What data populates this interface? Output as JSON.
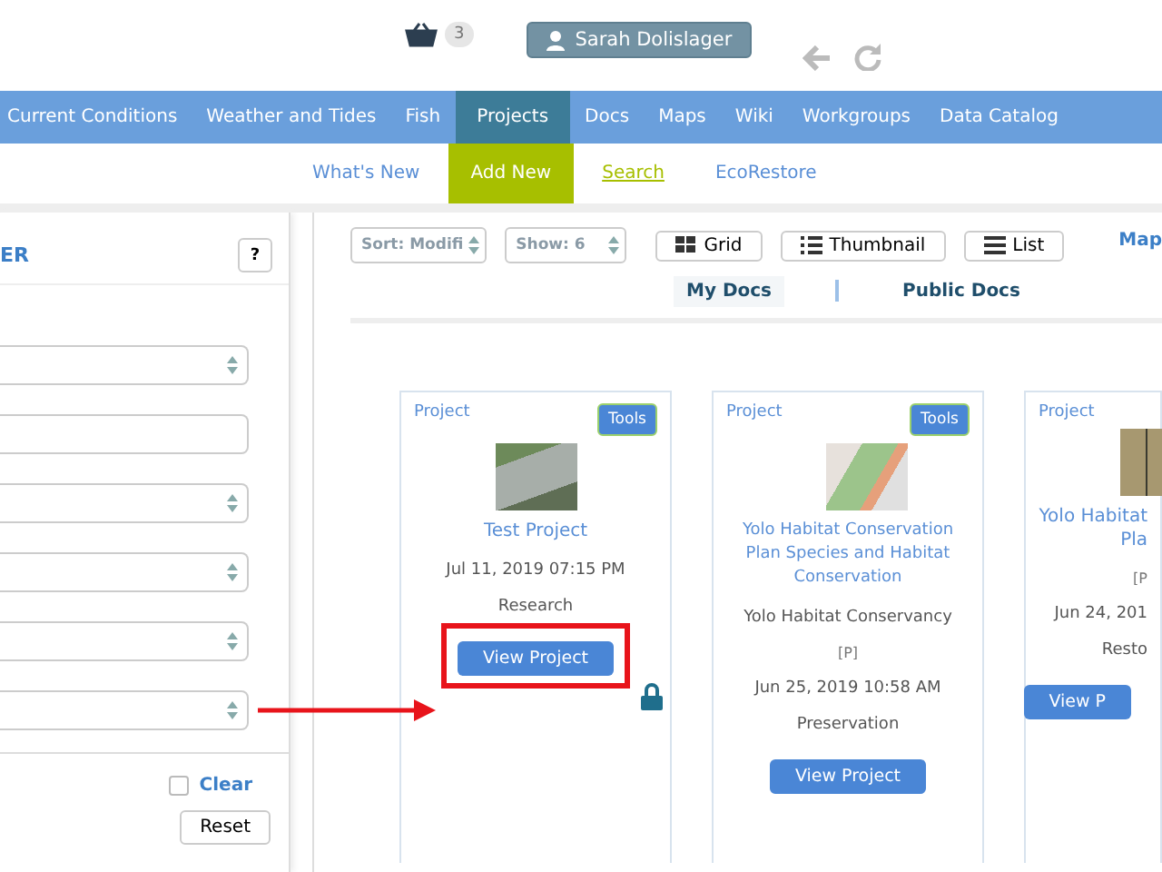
{
  "header": {
    "cart_count": "3",
    "user": "Sarah Dolislager"
  },
  "nav": [
    {
      "label": "Current Conditions",
      "selected": false
    },
    {
      "label": "Weather and Tides",
      "selected": false
    },
    {
      "label": "Fish",
      "selected": false
    },
    {
      "label": "Projects",
      "selected": true
    },
    {
      "label": "Docs",
      "selected": false
    },
    {
      "label": "Maps",
      "selected": false
    },
    {
      "label": "Wiki",
      "selected": false
    },
    {
      "label": "Workgroups",
      "selected": false
    },
    {
      "label": "Data Catalog",
      "selected": false
    }
  ],
  "subnav": [
    {
      "label": "What's New",
      "selected": false,
      "underlined": false
    },
    {
      "label": "Add New",
      "selected": true,
      "underlined": false
    },
    {
      "label": "Search",
      "selected": false,
      "underlined": true
    },
    {
      "label": "EcoRestore",
      "selected": false,
      "underlined": false
    }
  ],
  "filter_panel": {
    "title": "ER",
    "help": "?",
    "fields": [
      {
        "kind": "select"
      },
      {
        "kind": "input"
      },
      {
        "kind": "select"
      },
      {
        "kind": "select"
      },
      {
        "kind": "select"
      },
      {
        "kind": "select"
      }
    ],
    "clear": {
      "label": "Clear",
      "checked": false
    },
    "reset": "Reset"
  },
  "toolbar": {
    "sort": "Sort: Modifi",
    "show": "Show: 6",
    "views": [
      {
        "kind": "grid",
        "label": "Grid"
      },
      {
        "kind": "thumbnail",
        "label": "Thumbnail"
      },
      {
        "kind": "list",
        "label": "List"
      }
    ],
    "map": "Map"
  },
  "doc_tabs": [
    {
      "label": "My Docs",
      "selected": true
    },
    {
      "label": "Public Docs",
      "selected": false
    }
  ],
  "cards": [
    {
      "type": "Project",
      "tools": "Tools",
      "title": [
        "Test Project"
      ],
      "date": "Jul 11, 2019 07:15 PM",
      "category": "Research",
      "button": "View Project",
      "highlighted": true,
      "locked": true
    },
    {
      "type": "Project",
      "tools": "Tools",
      "title": [
        "Yolo Habitat Conservation",
        "Plan Species and Habitat",
        "Conservation"
      ],
      "org": "Yolo Habitat Conservancy",
      "flag": "[P]",
      "date": "Jun 25, 2019 10:58 AM",
      "category": "Preservation",
      "button": "View Project",
      "highlighted": false,
      "locked": false
    },
    {
      "type": "Project",
      "title": [
        "Yolo Habitat",
        "Pla"
      ],
      "flag": "[P",
      "date": "Jun 24, 201",
      "category": "Resto",
      "button": "View P",
      "highlighted": false,
      "locked": false
    }
  ]
}
